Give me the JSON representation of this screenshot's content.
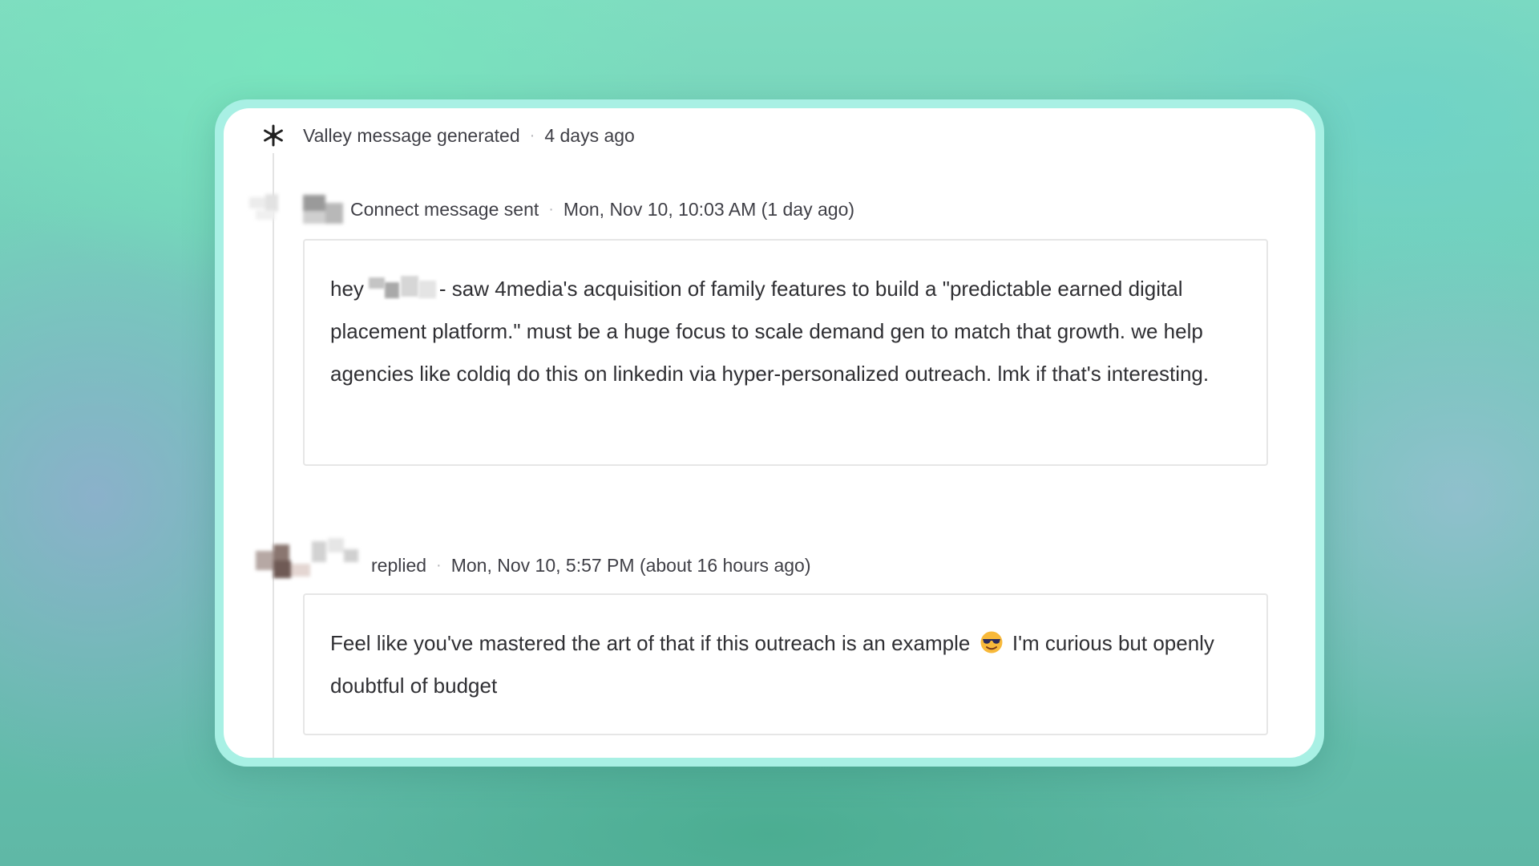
{
  "timeline": {
    "events": [
      {
        "label": "Valley message generated",
        "time": "4 days ago",
        "icon": "sparkle-icon"
      },
      {
        "label": "Connect message sent",
        "time": "Mon, Nov 10, 10:03 AM (1 day ago)",
        "message": {
          "greeting": "hey",
          "body": "- saw 4media's acquisition of family features to build a \"predictable earned digital placement platform.\" must be a huge focus to scale demand gen to match that growth. we help agencies like coldiq do this on linkedin via hyper-personalized outreach. lmk if that's interesting."
        }
      },
      {
        "label": "replied",
        "time": "Mon, Nov 10, 5:57 PM (about 16 hours ago)",
        "message": {
          "part1": "Feel like you've mastered the art of that if this outreach is an example",
          "emoji": "smiling-face-with-sunglasses-icon",
          "part2": "I'm curious but openly doubtful of budget"
        }
      }
    ],
    "separator": "·"
  },
  "colors": {
    "card_border_glow": "#a8f0e4",
    "card_background": "#ffffff",
    "timeline_line": "#e3e3e3",
    "text_primary": "#2f2f33",
    "text_meta": "#3f3f46"
  }
}
